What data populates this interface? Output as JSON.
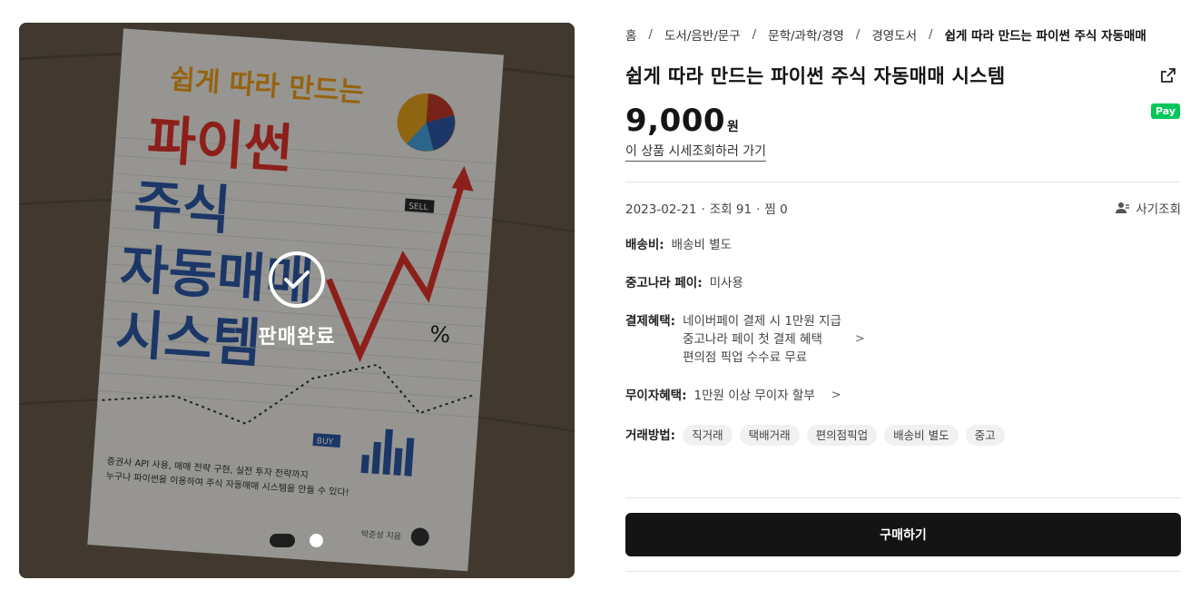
{
  "gallery": {
    "sold_label": "판매완료",
    "book_cover": {
      "top_line": "쉽게 따라 만드는",
      "title_1": "파이썬",
      "title_2": "주식",
      "title_3": "자동매매",
      "title_4": "시스템",
      "sell_tag": "SELL",
      "buy_tag": "BUY",
      "blurb_1": "증권사 API 사용, 매매 전략 구현, 실전 투자 전략까지",
      "blurb_2": "누구나 파이썬을 이용하여 주식 자동매매 시스템을 만들 수 있다!",
      "author": "박준성 지음",
      "percent": "%"
    },
    "slide_count": 2,
    "active_slide": 1
  },
  "breadcrumb": {
    "items": [
      "홈",
      "도서/음반/문구",
      "문학/과학/경영",
      "경영도서"
    ],
    "current": "쉽게 따라 만드는 파이썬 주식 자동매매",
    "separator": "/"
  },
  "product": {
    "title": "쉽게 따라 만드는 파이썬 주식 자동매매 시스템",
    "price": "9,000",
    "price_unit": "원",
    "pay_badge": "Pay",
    "market_link": "이 상품 시세조회하러 가기"
  },
  "meta": {
    "date": "2023-02-21",
    "views": "조회 91",
    "likes": "찜 0",
    "history": "사기조회"
  },
  "fields": {
    "shipping_label": "배송비:",
    "shipping_value": "배송비 별도",
    "pay_label": "중고나라 페이:",
    "pay_value": "미사용",
    "benefit_label": "결제혜택:",
    "benefits": [
      "네이버페이 결제 시 1만원 지급",
      "중고나라 페이 첫 결제 혜택",
      "편의점 픽업 수수료 무료"
    ],
    "interest_label": "무이자혜택:",
    "interest_value": "1만원 이상 무이자 할부",
    "trade_label": "거래방법:",
    "trade_tags": [
      "직거래",
      "택배거래",
      "편의점픽업",
      "배송비 별도",
      "중고"
    ]
  },
  "chevron": ">",
  "buy_button": "구매하기",
  "colors": {
    "pay_badge": "#03c75a",
    "buy_button": "#141414"
  }
}
